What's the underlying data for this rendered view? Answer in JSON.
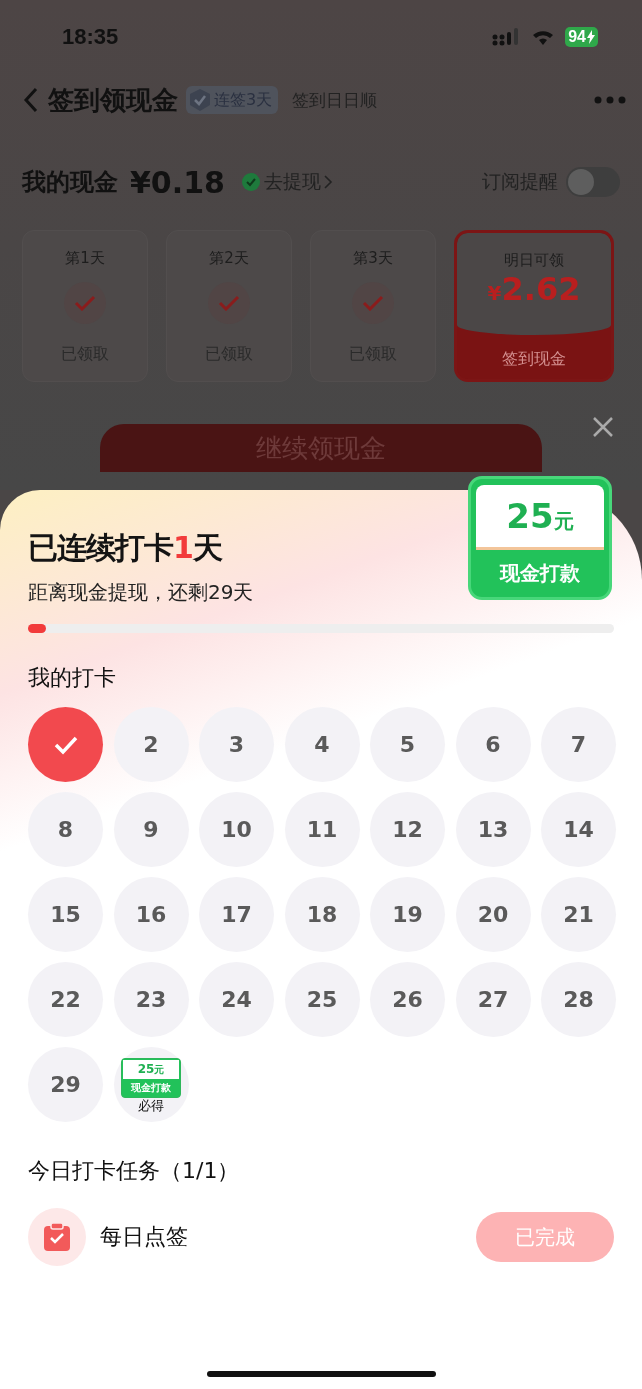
{
  "status_bar": {
    "time": "18:35",
    "battery": "94"
  },
  "nav": {
    "title": "签到领现金",
    "badge": "连签3天",
    "subtitle": "签到日日顺"
  },
  "cash": {
    "label": "我的现金",
    "amount": "¥0.18",
    "withdraw": "去提现",
    "subscribe_label": "订阅提醒",
    "subscribe_on": false
  },
  "day_cards": [
    {
      "day": "第1天",
      "status": "已领取",
      "claimed": true
    },
    {
      "day": "第2天",
      "status": "已领取",
      "claimed": true
    },
    {
      "day": "第3天",
      "status": "已领取",
      "claimed": true
    }
  ],
  "tomorrow_card": {
    "label": "明日可领",
    "currency": "¥",
    "amount": "2.62",
    "caption": "签到现金"
  },
  "continue_button": "继续领现金",
  "sheet": {
    "title_prefix": "已连续打卡",
    "streak": "1",
    "title_suffix": "天",
    "subtitle": "距离现金提现，还剩29天",
    "progress": {
      "level": 0.03
    },
    "reward_badge": {
      "amount": "25",
      "unit": "元",
      "caption": "现金打款"
    },
    "calendar_title": "我的打卡",
    "days": [
      {
        "kind": "day",
        "checked": true
      },
      {
        "kind": "day",
        "label": "2",
        "checked": false
      },
      {
        "kind": "day",
        "label": "3",
        "checked": false
      },
      {
        "kind": "day",
        "label": "4",
        "checked": false
      },
      {
        "kind": "day",
        "label": "5",
        "checked": false
      },
      {
        "kind": "day",
        "label": "6",
        "checked": false
      },
      {
        "kind": "day",
        "label": "7",
        "checked": false
      },
      {
        "kind": "day",
        "label": "8",
        "checked": false
      },
      {
        "kind": "day",
        "label": "9",
        "checked": false
      },
      {
        "kind": "day",
        "label": "10",
        "checked": false
      },
      {
        "kind": "day",
        "label": "11",
        "checked": false
      },
      {
        "kind": "day",
        "label": "12",
        "checked": false
      },
      {
        "kind": "day",
        "label": "13",
        "checked": false
      },
      {
        "kind": "day",
        "label": "14",
        "checked": false
      },
      {
        "kind": "day",
        "label": "15",
        "checked": false
      },
      {
        "kind": "day",
        "label": "16",
        "checked": false
      },
      {
        "kind": "day",
        "label": "17",
        "checked": false
      },
      {
        "kind": "day",
        "label": "18",
        "checked": false
      },
      {
        "kind": "day",
        "label": "19",
        "checked": false
      },
      {
        "kind": "day",
        "label": "20",
        "checked": false
      },
      {
        "kind": "day",
        "label": "21",
        "checked": false
      },
      {
        "kind": "day",
        "label": "22",
        "checked": false
      },
      {
        "kind": "day",
        "label": "23",
        "checked": false
      },
      {
        "kind": "day",
        "label": "24",
        "checked": false
      },
      {
        "kind": "day",
        "label": "25",
        "checked": false
      },
      {
        "kind": "day",
        "label": "26",
        "checked": false
      },
      {
        "kind": "day",
        "label": "27",
        "checked": false
      },
      {
        "kind": "day",
        "label": "28",
        "checked": false
      },
      {
        "kind": "day",
        "label": "29",
        "checked": false
      },
      {
        "kind": "reward",
        "amount": "25",
        "unit": "元",
        "caption": "现金打款",
        "label": "必得"
      }
    ],
    "tasks_title": "今日打卡任务（1/1）",
    "tasks": [
      {
        "name": "每日点签",
        "button": "已完成",
        "done": true
      }
    ]
  }
}
